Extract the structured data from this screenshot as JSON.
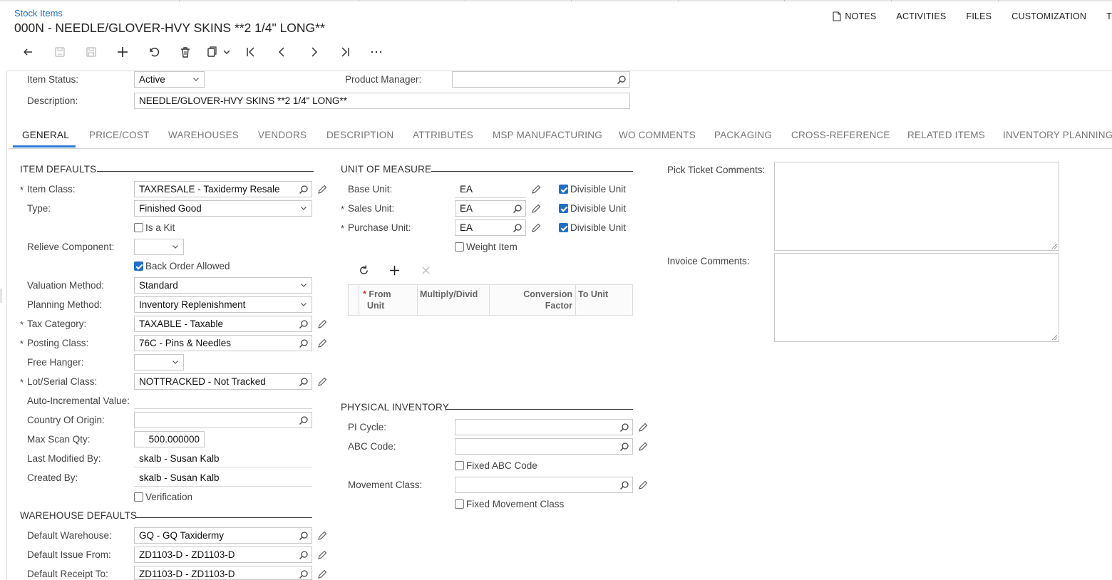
{
  "header": {
    "breadcrumb": "Stock Items",
    "title": "000N - NEEDLE/GLOVER-HVY SKINS **2 1/4\" LONG**",
    "actions": [
      "NOTES",
      "ACTIVITIES",
      "FILES",
      "CUSTOMIZATION",
      "T"
    ]
  },
  "toolbar_icons": [
    "back-icon",
    "save-close-icon",
    "save-icon",
    "add-icon",
    "undo-icon",
    "delete-icon",
    "copy-paste-icon",
    "first-record-icon",
    "previous-icon",
    "next-icon",
    "last-record-icon",
    "more-icon"
  ],
  "summary": {
    "item_status_label": "Item Status:",
    "item_status_value": "Active",
    "product_manager_label": "Product Manager:",
    "product_manager_value": "",
    "description_label": "Description:",
    "description_value": "NEEDLE/GLOVER-HVY SKINS **2 1/4\" LONG**"
  },
  "tabs": [
    "GENERAL",
    "PRICE/COST",
    "WAREHOUSES",
    "VENDORS",
    "DESCRIPTION",
    "ATTRIBUTES",
    "MSP MANUFACTURING",
    "WO COMMENTS",
    "PACKAGING",
    "CROSS-REFERENCE",
    "RELATED ITEMS",
    "INVENTORY PLANNING"
  ],
  "item_defaults": {
    "title": "ITEM DEFAULTS",
    "item_class_label": "Item Class:",
    "item_class_value": "TAXRESALE - Taxidermy Resale",
    "type_label": "Type:",
    "type_value": "Finished Good",
    "is_kit_label": "Is a Kit",
    "relieve_component_label": "Relieve Component:",
    "back_order_label": "Back Order Allowed",
    "valuation_label": "Valuation Method:",
    "valuation_value": "Standard",
    "planning_label": "Planning Method:",
    "planning_value": "Inventory Replenishment",
    "tax_category_label": "Tax Category:",
    "tax_category_value": "TAXABLE - Taxable",
    "posting_class_label": "Posting Class:",
    "posting_class_value": "76C - Pins & Needles",
    "free_hanger_label": "Free Hanger:",
    "lot_serial_label": "Lot/Serial Class:",
    "lot_serial_value": "NOTTRACKED - Not Tracked",
    "auto_incremental_label": "Auto-Incremental Value:",
    "country_label": "Country Of Origin:",
    "country_value": "",
    "max_scan_label": "Max Scan Qty:",
    "max_scan_value": "500.000000",
    "last_modified_label": "Last Modified By:",
    "last_modified_value": "skalb - Susan Kalb",
    "created_by_label": "Created By:",
    "created_by_value": "skalb - Susan Kalb",
    "verification_label": "Verification"
  },
  "warehouse_defaults": {
    "title": "WAREHOUSE DEFAULTS",
    "default_warehouse_label": "Default Warehouse:",
    "default_warehouse_value": "GQ - GQ Taxidermy",
    "issue_from_label": "Default Issue From:",
    "issue_from_value": "ZD1103-D - ZD1103-D",
    "receipt_to_label": "Default Receipt To:",
    "receipt_to_value": "ZD1103-D - ZD1103-D"
  },
  "uom": {
    "title": "UNIT OF MEASURE",
    "base_unit_label": "Base Unit:",
    "base_unit_value": "EA",
    "sales_unit_label": "Sales Unit:",
    "sales_unit_value": "EA",
    "purchase_unit_label": "Purchase Unit:",
    "purchase_unit_value": "EA",
    "divisible_label": "Divisible Unit",
    "weight_item_label": "Weight Item",
    "grid_headers": {
      "from_unit_1": "From",
      "from_unit_2": "Unit",
      "multiply": "Multiply/Divid",
      "conversion_1": "Conversion",
      "conversion_2": "Factor",
      "to_unit": "To Unit"
    }
  },
  "physical_inventory": {
    "title": "PHYSICAL INVENTORY",
    "pi_cycle_label": "PI Cycle:",
    "pi_cycle_value": "",
    "abc_code_label": "ABC Code:",
    "abc_code_value": "",
    "fixed_abc_label": "Fixed ABC Code",
    "movement_class_label": "Movement Class:",
    "movement_class_value": "",
    "fixed_movement_label": "Fixed Movement Class"
  },
  "comments": {
    "pick_ticket_label": "Pick Ticket Comments:",
    "invoice_label": "Invoice Comments:"
  },
  "colors": {
    "link": "#1b6fbf",
    "accent": "#2b7bd6",
    "checkbox": "#1f6fc9"
  }
}
